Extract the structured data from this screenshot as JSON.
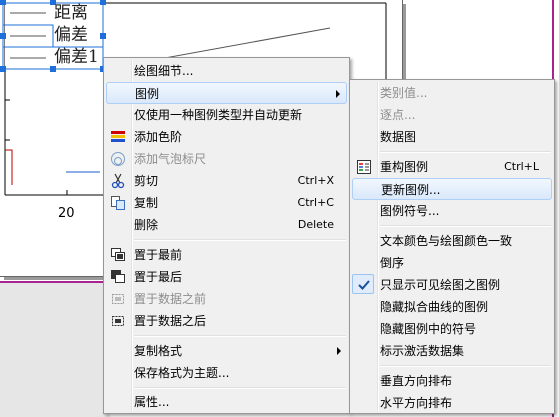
{
  "graph": {
    "legend": [
      "距离",
      "偏差",
      "偏差1"
    ],
    "x_tick": "20"
  },
  "main_menu": {
    "items": [
      {
        "label": "绘图细节...",
        "shortcut": "",
        "disabled": false,
        "icon": ""
      },
      {
        "label": "图例",
        "shortcut": "",
        "disabled": false,
        "icon": "",
        "submenu": true,
        "highlighted": true
      },
      {
        "label": "仅使用一种图例类型并自动更新",
        "shortcut": "",
        "disabled": false,
        "icon": ""
      },
      {
        "label": "添加色阶",
        "shortcut": "",
        "disabled": false,
        "icon": "color-scale-icon"
      },
      {
        "label": "添加气泡标尺",
        "shortcut": "",
        "disabled": true,
        "icon": "bubble-scale-icon"
      },
      {
        "label": "剪切",
        "shortcut": "Ctrl+X",
        "disabled": false,
        "icon": "scissors-icon"
      },
      {
        "label": "复制",
        "shortcut": "Ctrl+C",
        "disabled": false,
        "icon": "copy-icon"
      },
      {
        "label": "删除",
        "shortcut": "Delete",
        "disabled": false,
        "icon": ""
      },
      {
        "label": "置于最前",
        "shortcut": "",
        "disabled": false,
        "icon": "bring-to-front-icon"
      },
      {
        "label": "置于最后",
        "shortcut": "",
        "disabled": false,
        "icon": "send-to-back-icon"
      },
      {
        "label": "置于数据之前",
        "shortcut": "",
        "disabled": true,
        "icon": "in-front-of-data-icon"
      },
      {
        "label": "置于数据之后",
        "shortcut": "",
        "disabled": false,
        "icon": "behind-data-icon"
      },
      {
        "label": "复制格式",
        "shortcut": "",
        "disabled": false,
        "icon": "",
        "submenu": true
      },
      {
        "label": "保存格式为主题...",
        "shortcut": "",
        "disabled": false,
        "icon": ""
      },
      {
        "label": "属性...",
        "shortcut": "",
        "disabled": false,
        "icon": ""
      }
    ]
  },
  "legend_submenu": {
    "items": [
      {
        "label": "类别值...",
        "shortcut": "",
        "disabled": true,
        "icon": ""
      },
      {
        "label": "逐点...",
        "shortcut": "",
        "disabled": true,
        "icon": ""
      },
      {
        "label": "数据图",
        "shortcut": "",
        "disabled": false,
        "icon": ""
      },
      {
        "label": "重构图例",
        "shortcut": "Ctrl+L",
        "disabled": false,
        "icon": "reconstruct-legend-icon"
      },
      {
        "label": "更新图例...",
        "shortcut": "",
        "disabled": false,
        "icon": "",
        "highlighted": true
      },
      {
        "label": "图例符号...",
        "shortcut": "",
        "disabled": false,
        "icon": ""
      },
      {
        "label": "文本颜色与绘图颜色一致",
        "shortcut": "",
        "disabled": false,
        "icon": ""
      },
      {
        "label": "倒序",
        "shortcut": "",
        "disabled": false,
        "icon": ""
      },
      {
        "label": "只显示可见绘图之图例",
        "shortcut": "",
        "disabled": false,
        "icon": "check-icon",
        "checked": true
      },
      {
        "label": "隐藏拟合曲线的图例",
        "shortcut": "",
        "disabled": false,
        "icon": ""
      },
      {
        "label": "隐藏图例中的符号",
        "shortcut": "",
        "disabled": false,
        "icon": ""
      },
      {
        "label": "标示激活数据集",
        "shortcut": "",
        "disabled": false,
        "icon": ""
      },
      {
        "label": "垂直方向排布",
        "shortcut": "",
        "disabled": false,
        "icon": ""
      },
      {
        "label": "水平方向排布",
        "shortcut": "",
        "disabled": false,
        "icon": ""
      }
    ]
  },
  "colors": {
    "menu_bg": "#f0f0f0",
    "highlight_border": "#aecff7",
    "selection_handle": "#1e6fd9",
    "accent_magenta": "#a8238f"
  }
}
